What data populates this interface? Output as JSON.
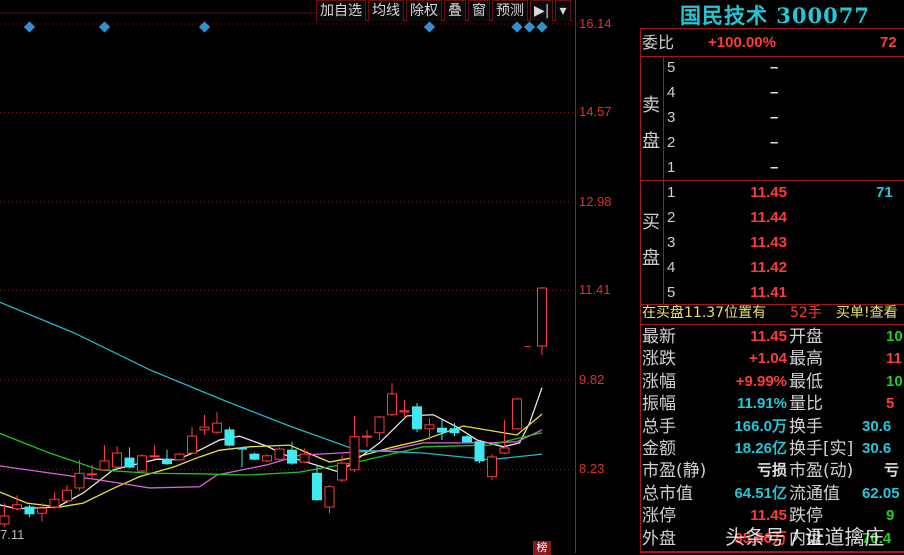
{
  "toolbar": {
    "buttons": [
      "加自选",
      "均线",
      "除权",
      "叠",
      "窗",
      "预测",
      "▶|",
      "▾"
    ]
  },
  "axis": {
    "price_labels": [
      "16.14",
      "14.57",
      "12.98",
      "11.41",
      "9.82",
      "8.23"
    ],
    "date_label": "7.11",
    "rank_badge": "榜"
  },
  "colors": {
    "up": "#ff3a3a",
    "down": "#40e8f0",
    "ma5": "#e8e8e8",
    "ma10": "#e8e040",
    "ma20": "#e060e0",
    "ma30": "#20c020",
    "ma60": "#20b8c8",
    "marker": "#3090d0"
  },
  "chart_data": {
    "type": "candlestick",
    "price_levels": [
      16.14,
      14.57,
      12.98,
      11.41,
      9.82,
      8.23
    ],
    "ylim": [
      7.0,
      16.14
    ],
    "candles": [
      [
        7.26,
        7.63,
        7.21,
        7.4
      ],
      [
        7.53,
        7.77,
        7.5,
        7.6
      ],
      [
        7.56,
        7.6,
        7.38,
        7.44
      ],
      [
        7.45,
        7.63,
        7.3,
        7.54
      ],
      [
        7.56,
        7.82,
        7.53,
        7.7
      ],
      [
        7.67,
        7.95,
        7.65,
        7.86
      ],
      [
        7.9,
        8.4,
        7.85,
        8.16
      ],
      [
        8.14,
        8.31,
        8.07,
        8.15
      ],
      [
        8.22,
        8.66,
        8.2,
        8.38
      ],
      [
        8.27,
        8.64,
        8.25,
        8.52
      ],
      [
        8.43,
        8.62,
        8.25,
        8.27
      ],
      [
        8.2,
        8.5,
        8.18,
        8.47
      ],
      [
        8.46,
        8.66,
        8.42,
        8.47
      ],
      [
        8.41,
        8.58,
        8.31,
        8.33
      ],
      [
        8.4,
        8.52,
        8.38,
        8.5
      ],
      [
        8.52,
        8.98,
        8.5,
        8.82
      ],
      [
        8.93,
        9.2,
        8.84,
        8.98
      ],
      [
        8.89,
        9.25,
        8.86,
        9.05
      ],
      [
        8.93,
        8.98,
        8.64,
        8.66
      ],
      [
        8.61,
        8.63,
        8.27,
        8.59
      ],
      [
        8.5,
        8.53,
        8.39,
        8.41
      ],
      [
        8.38,
        8.5,
        8.36,
        8.47
      ],
      [
        8.41,
        8.62,
        8.39,
        8.59
      ],
      [
        8.57,
        8.72,
        8.31,
        8.34
      ],
      [
        8.36,
        8.6,
        8.34,
        8.5
      ],
      [
        8.16,
        8.31,
        7.67,
        7.69
      ],
      [
        7.56,
        7.95,
        7.45,
        7.92
      ],
      [
        8.04,
        8.48,
        8.0,
        8.34
      ],
      [
        8.22,
        9.18,
        8.18,
        8.81
      ],
      [
        8.81,
        8.93,
        8.63,
        8.82
      ],
      [
        8.88,
        9.18,
        8.75,
        9.16
      ],
      [
        9.2,
        9.76,
        9.18,
        9.57
      ],
      [
        9.25,
        9.46,
        9.14,
        9.27
      ],
      [
        9.34,
        9.41,
        8.89,
        8.95
      ],
      [
        8.95,
        9.14,
        8.75,
        9.02
      ],
      [
        8.96,
        9.11,
        8.75,
        8.89
      ],
      [
        8.95,
        9.05,
        8.82,
        8.88
      ],
      [
        8.81,
        8.84,
        8.7,
        8.72
      ],
      [
        8.72,
        8.75,
        8.34,
        8.38
      ],
      [
        8.1,
        8.5,
        8.04,
        8.45
      ],
      [
        8.52,
        9.11,
        8.5,
        8.61
      ],
      [
        8.95,
        9.5,
        8.93,
        9.48
      ],
      [
        10.41,
        10.41,
        10.41,
        10.41
      ],
      [
        10.42,
        11.47,
        10.26,
        11.45
      ]
    ],
    "ma_lines": [
      {
        "name": "MA5",
        "color": "#e8e8e8",
        "points": [
          [
            -0.4,
            7.6
          ],
          [
            1,
            7.53
          ],
          [
            4.2,
            7.56
          ],
          [
            6.3,
            7.81
          ],
          [
            8.7,
            8.22
          ],
          [
            10.3,
            8.31
          ],
          [
            12.2,
            8.41
          ],
          [
            13.8,
            8.4
          ],
          [
            15.6,
            8.57
          ],
          [
            17.2,
            8.75
          ],
          [
            18.8,
            8.82
          ],
          [
            21,
            8.64
          ],
          [
            22.8,
            8.45
          ],
          [
            26.8,
            8.18
          ],
          [
            30,
            8.7
          ],
          [
            32.2,
            9.18
          ],
          [
            34.3,
            9.2
          ],
          [
            36.2,
            8.98
          ],
          [
            37.8,
            8.75
          ],
          [
            39.9,
            8.63
          ],
          [
            41.2,
            8.7
          ],
          [
            42,
            9.05
          ],
          [
            43,
            9.68
          ]
        ]
      },
      {
        "name": "MA10",
        "color": "#e8e040",
        "points": [
          [
            -0.4,
            7.83
          ],
          [
            1.8,
            7.63
          ],
          [
            4.4,
            7.56
          ],
          [
            6.3,
            7.63
          ],
          [
            8.4,
            7.86
          ],
          [
            10.8,
            8.1
          ],
          [
            13.5,
            8.27
          ],
          [
            15.6,
            8.45
          ],
          [
            17.2,
            8.57
          ],
          [
            19.6,
            8.63
          ],
          [
            22.8,
            8.66
          ],
          [
            26,
            8.36
          ],
          [
            28.2,
            8.45
          ],
          [
            30.8,
            8.61
          ],
          [
            33.5,
            8.75
          ],
          [
            36.7,
            9.0
          ],
          [
            39.9,
            8.88
          ],
          [
            41,
            8.84
          ],
          [
            43,
            9.21
          ]
        ]
      },
      {
        "name": "MA20",
        "color": "#e060e0",
        "points": [
          [
            -0.4,
            8.29
          ],
          [
            7.6,
            8.04
          ],
          [
            11.6,
            7.9
          ],
          [
            15.6,
            7.92
          ],
          [
            17,
            8.13
          ],
          [
            21,
            8.31
          ],
          [
            23.6,
            8.48
          ],
          [
            30.8,
            8.57
          ],
          [
            33.5,
            8.7
          ],
          [
            38.8,
            8.7
          ],
          [
            41,
            8.72
          ],
          [
            43,
            8.93
          ]
        ]
      },
      {
        "name": "MA30",
        "color": "#20c020",
        "points": [
          [
            -0.4,
            8.87
          ],
          [
            3.6,
            8.52
          ],
          [
            7.6,
            8.22
          ],
          [
            11.6,
            8.16
          ],
          [
            15.6,
            8.15
          ],
          [
            19.6,
            8.13
          ],
          [
            23.6,
            8.18
          ],
          [
            28.2,
            8.36
          ],
          [
            33.5,
            8.63
          ],
          [
            38.8,
            8.66
          ],
          [
            43,
            8.88
          ]
        ]
      },
      {
        "name": "MA60",
        "color": "#20b8c8",
        "points": [
          [
            -0.4,
            11.2
          ],
          [
            5.6,
            10.65
          ],
          [
            11.6,
            10.0
          ],
          [
            17.6,
            9.45
          ],
          [
            22.8,
            9.0
          ],
          [
            28.2,
            8.57
          ],
          [
            33.5,
            8.52
          ],
          [
            38.8,
            8.4
          ],
          [
            43,
            8.5
          ]
        ]
      }
    ],
    "event_markers": [
      2,
      8,
      16,
      34,
      41,
      42,
      43
    ]
  },
  "quote": {
    "title": "国民技术 300077",
    "weibi_label": "委比",
    "weibi_value": "+100.00%",
    "weibi_diff": "72",
    "sell_label": "卖盘",
    "sell": [
      {
        "level": "5",
        "price": "–"
      },
      {
        "level": "4",
        "price": "–"
      },
      {
        "level": "3",
        "price": "–"
      },
      {
        "level": "2",
        "price": "–"
      },
      {
        "level": "1",
        "price": "–"
      }
    ],
    "buy_label": "买盘",
    "buy": [
      {
        "level": "1",
        "price": "11.45",
        "volume": "71"
      },
      {
        "level": "2",
        "price": "11.44",
        "volume": ""
      },
      {
        "level": "3",
        "price": "11.43",
        "volume": ""
      },
      {
        "level": "4",
        "price": "11.42",
        "volume": ""
      },
      {
        "level": "5",
        "price": "11.41",
        "volume": ""
      }
    ],
    "notice": {
      "text": "在买盘11.37位置有",
      "qty": "52手",
      "link": "买单!查看"
    },
    "stats": [
      {
        "l1": "最新",
        "v1": "11.45",
        "c1": "red",
        "l2": "开盘",
        "v2": "10",
        "c2": "green"
      },
      {
        "l1": "涨跌",
        "v1": "+1.04",
        "c1": "red",
        "l2": "最高",
        "v2": "11",
        "c2": "red"
      },
      {
        "l1": "涨幅",
        "v1": "+9.99%",
        "c1": "red",
        "l2": "最低",
        "v2": "10",
        "c2": "green"
      },
      {
        "l1": "振幅",
        "v1": "11.91%",
        "c1": "cyan",
        "l2": "量比",
        "v2": "5",
        "c2": "red"
      },
      {
        "l1": "总手",
        "v1": "166.0万",
        "c1": "cyan",
        "l2": "换手",
        "v2": "30.6",
        "c2": "cyan"
      },
      {
        "l1": "金额",
        "v1": "18.26亿",
        "c1": "cyan",
        "l2": "换手[实]",
        "v2": "30.6",
        "c2": "cyan"
      },
      {
        "l1": "市盈(静)",
        "v1": "亏损",
        "c1": "white",
        "l2": "市盈(动)",
        "v2": "亏",
        "c2": "white"
      },
      {
        "l1": "总市值",
        "v1": "64.51亿",
        "c1": "cyan",
        "l2": "流通值",
        "v2": "62.05",
        "c2": "cyan"
      },
      {
        "l1": "涨停",
        "v1": "11.45",
        "c1": "red",
        "l2": "跌停",
        "v2": "9",
        "c2": "green"
      },
      {
        "l1": "外盘",
        "v1": "95.56万",
        "c1": "red",
        "l2": "内盘",
        "v2": "70.4",
        "c2": "green"
      }
    ]
  },
  "watermark": "头条号 / 证道擒庄"
}
